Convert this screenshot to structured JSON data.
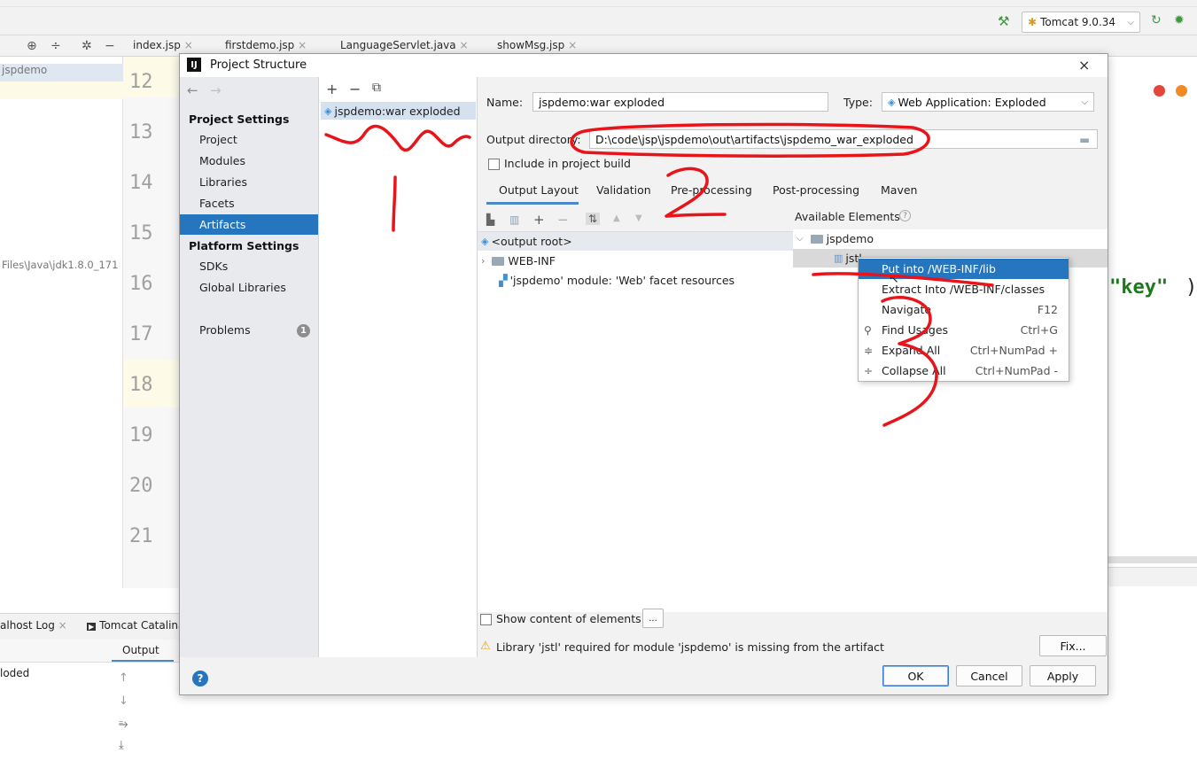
{
  "ide": {
    "run_config": "Tomcat 9.0.34",
    "editor_tabs": [
      "index.jsp",
      "firstdemo.jsp",
      "LanguageServlet.java",
      "showMsg.jsp"
    ],
    "project_root": "jspdemo",
    "project_path_fragment": "Files\\Java\\jdk1.8.0_171",
    "line_numbers": [
      "12",
      "13",
      "14",
      "15",
      "16",
      "17",
      "18",
      "19",
      "20",
      "21"
    ],
    "code_fragment": "\"key\"",
    "code_paren": ")",
    "bottom_tabs": [
      "alhost Log",
      "Tomcat Catalina"
    ],
    "output_label": "Output",
    "output_text": "loded"
  },
  "dialog": {
    "title": "Project Structure",
    "close_glyph": "×",
    "nav": {
      "back": "←",
      "forward": "→",
      "project_settings_header": "Project Settings",
      "project_settings": [
        "Project",
        "Modules",
        "Libraries",
        "Facets",
        "Artifacts"
      ],
      "platform_settings_header": "Platform Settings",
      "platform_settings": [
        "SDKs",
        "Global Libraries"
      ],
      "problems_label": "Problems",
      "problems_count": "1"
    },
    "artifact_list": {
      "add": "+",
      "remove": "−",
      "copy": "⧉",
      "items": [
        "jspdemo:war exploded"
      ]
    },
    "name_label": "Name:",
    "name_value": "jspdemo:war exploded",
    "type_label": "Type:",
    "type_value": "Web Application: Exploded",
    "output_dir_label": "Output directory:",
    "output_dir_value": "D:\\code\\jsp\\jspdemo\\out\\artifacts\\jspdemo_war_exploded",
    "include_build_label": "Include in project build",
    "tabs": [
      "Output Layout",
      "Validation",
      "Pre-processing",
      "Post-processing",
      "Maven"
    ],
    "available_elements_label": "Available Elements",
    "layout_tree": {
      "root": "<output root>",
      "web_inf": "WEB-INF",
      "facet_resources": "'jspdemo' module: 'Web' facet resources"
    },
    "available_tree": {
      "module": "jspdemo",
      "library": "jstl"
    },
    "context_menu": [
      {
        "label": "Put into /WEB-INF/lib",
        "shortcut": ""
      },
      {
        "label": "Extract Into /WEB-INF/classes",
        "shortcut": ""
      },
      {
        "label": "Navigate",
        "shortcut": "F12"
      },
      {
        "label": "Find Usages",
        "shortcut": "Ctrl+G"
      },
      {
        "label": "Expand All",
        "shortcut": "Ctrl+NumPad +"
      },
      {
        "label": "Collapse All",
        "shortcut": "Ctrl+NumPad -"
      }
    ],
    "show_content_label": "Show content of elements",
    "ellipsis": "...",
    "warning_text": "Library 'jstl' required for module 'jspdemo' is missing from the artifact",
    "fix_label": "Fix...",
    "ok_label": "OK",
    "cancel_label": "Cancel",
    "apply_label": "Apply",
    "help_glyph": "?"
  },
  "annotation_color": "#e8141a"
}
